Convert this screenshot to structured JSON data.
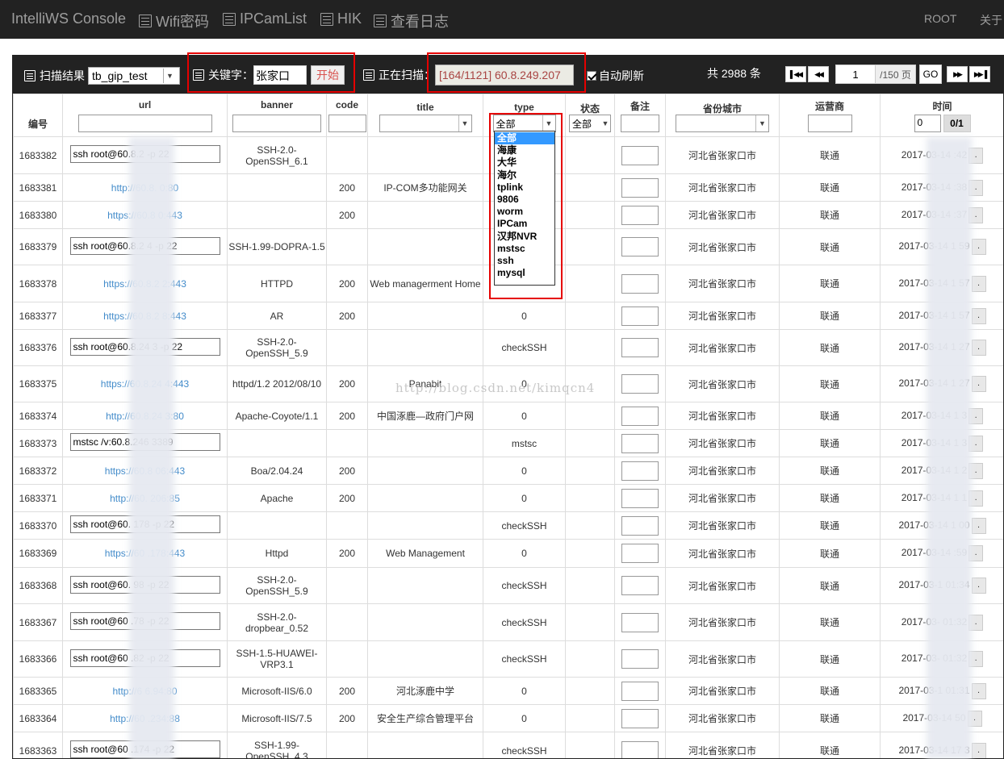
{
  "nav": {
    "brand": "IntelliWS Console",
    "items": [
      "Wifi密码",
      "IPCamList",
      "HIK",
      "查看日志"
    ],
    "right": [
      "ROOT",
      "关于"
    ]
  },
  "toolbar": {
    "scan_result_label": "扫描结果",
    "scan_result_value": "tb_gip_test",
    "keyword_label": "关键字：",
    "keyword_value": "张家口",
    "start_button": "开始",
    "scanning_label": "正在扫描：",
    "scanning_value": "[164/1121] 60.8.249.207",
    "auto_refresh_label": "自动刷新",
    "total_text": "共 2988 条",
    "page_value": "1",
    "page_total": "/150 页",
    "go_button": "GO"
  },
  "columns": {
    "id": "编号",
    "url": "url",
    "banner": "banner",
    "code": "code",
    "title": "title",
    "type": "type",
    "status": "状态",
    "note": "备注",
    "region": "省份城市",
    "isp": "运营商",
    "time": "时间"
  },
  "filters": {
    "type_selected": "全部",
    "status_selected": "全部",
    "time_from": "0",
    "time_button": "0/1"
  },
  "type_options": [
    "全部",
    "海康",
    "大华",
    "海尔",
    "tplink",
    "9806",
    "worm",
    "IPCam",
    "汉邦NVR",
    "mstsc",
    "ssh",
    "mysql"
  ],
  "watermark": "http://blog.csdn.net/kimqcn4",
  "time_button_label": ".",
  "rows": [
    {
      "id": "1683382",
      "url": "ssh root@60.8.2 -p 22",
      "url_kind": "input",
      "banner": "SSH-2.0-OpenSSH_6.1",
      "code": "",
      "title": "",
      "type": "",
      "region": "河北省张家口市",
      "isp": "联通",
      "time": "2017-03-14 :42"
    },
    {
      "id": "1683381",
      "url": "http://60.8. 0:80",
      "url_kind": "link",
      "banner": "",
      "code": "200",
      "title": "IP-COM多功能网关",
      "type": "",
      "region": "河北省张家口市",
      "isp": "联通",
      "time": "2017-03-14 :38"
    },
    {
      "id": "1683380",
      "url": "https://60.8 0:443",
      "url_kind": "link",
      "banner": "",
      "code": "200",
      "title": "",
      "type": "",
      "region": "河北省张家口市",
      "isp": "联通",
      "time": "2017-03-14 :37"
    },
    {
      "id": "1683379",
      "url": "ssh root@60.8.2 4 -p 22",
      "url_kind": "input",
      "banner": "SSH-1.99-DOPRA-1.5",
      "code": "",
      "title": "",
      "type": "",
      "region": "河北省张家口市",
      "isp": "联通",
      "time": "2017-03-14 1 59"
    },
    {
      "id": "1683378",
      "url": "https://60.8.2 2:443",
      "url_kind": "link",
      "banner": "HTTPD",
      "code": "200",
      "title": "Web managerment Home",
      "type": "",
      "region": "河北省张家口市",
      "isp": "联通",
      "time": "2017-03-14 1 57"
    },
    {
      "id": "1683377",
      "url": "https://60.8.2 8:443",
      "url_kind": "link",
      "banner": "AR",
      "code": "200",
      "title": "",
      "type": "0",
      "region": "河北省张家口市",
      "isp": "联通",
      "time": "2017-03-14 1 57"
    },
    {
      "id": "1683376",
      "url": "ssh root@60.8.24 3 -p 22",
      "url_kind": "input",
      "banner": "SSH-2.0-OpenSSH_5.9",
      "code": "",
      "title": "",
      "type": "checkSSH",
      "region": "河北省张家口市",
      "isp": "联通",
      "time": "2017-03-14 1 27"
    },
    {
      "id": "1683375",
      "url": "https://60.8.24 4:443",
      "url_kind": "link",
      "banner": "httpd/1.2 2012/08/10",
      "code": "200",
      "title": "Panabit",
      "type": "0",
      "region": "河北省张家口市",
      "isp": "联通",
      "time": "2017-03-14 1 27"
    },
    {
      "id": "1683374",
      "url": "http://60.8.24 3:80",
      "url_kind": "link",
      "banner": "Apache-Coyote/1.1",
      "code": "200",
      "title": "中国涿鹿—政府门户网",
      "type": "0",
      "region": "河北省张家口市",
      "isp": "联通",
      "time": "2017-03-14 1 3"
    },
    {
      "id": "1683373",
      "url": "mstsc /v:60.8.246 3389",
      "url_kind": "input",
      "banner": "",
      "code": "",
      "title": "",
      "type": "mstsc",
      "region": "河北省张家口市",
      "isp": "联通",
      "time": "2017-03-14 1 3"
    },
    {
      "id": "1683372",
      "url": "https://60.8 06:443",
      "url_kind": "link",
      "banner": "Boa/2.04.24",
      "code": "200",
      "title": "",
      "type": "0",
      "region": "河北省张家口市",
      "isp": "联通",
      "time": "2017-03-14 1 2"
    },
    {
      "id": "1683371",
      "url": "http://60. 206:85",
      "url_kind": "link",
      "banner": "Apache",
      "code": "200",
      "title": "",
      "type": "0",
      "region": "河北省张家口市",
      "isp": "联通",
      "time": "2017-03-14 1 1"
    },
    {
      "id": "1683370",
      "url": "ssh root@60. 178 -p 22",
      "url_kind": "input",
      "banner": "",
      "code": "",
      "title": "",
      "type": "checkSSH",
      "region": "河北省张家口市",
      "isp": "联通",
      "time": "2017-03-14 1 00"
    },
    {
      "id": "1683369",
      "url": "https://60 .178:443",
      "url_kind": "link",
      "banner": "Httpd",
      "code": "200",
      "title": "Web Management",
      "type": "0",
      "region": "河北省张家口市",
      "isp": "联通",
      "time": "2017-03-14 :59"
    },
    {
      "id": "1683368",
      "url": "ssh root@60. 98 -p 22",
      "url_kind": "input",
      "banner": "SSH-2.0-OpenSSH_5.9",
      "code": "",
      "title": "",
      "type": "checkSSH",
      "region": "河北省张家口市",
      "isp": "联通",
      "time": "2017-03-1 01:34"
    },
    {
      "id": "1683367",
      "url": "ssh root@60 .78 -p 22",
      "url_kind": "input",
      "banner": "SSH-2.0-dropbear_0.52",
      "code": "",
      "title": "",
      "type": "checkSSH",
      "region": "河北省张家口市",
      "isp": "联通",
      "time": "2017-03- 01:32"
    },
    {
      "id": "1683366",
      "url": "ssh root@60 .82 -p 22",
      "url_kind": "input",
      "banner": "SSH-1.5-HUAWEI-VRP3.1",
      "code": "",
      "title": "",
      "type": "checkSSH",
      "region": "河北省张家口市",
      "isp": "联通",
      "time": "2017-03- 01:32"
    },
    {
      "id": "1683365",
      "url": "http://6 6.94:80",
      "url_kind": "link",
      "banner": "Microsoft-IIS/6.0",
      "code": "200",
      "title": "河北涿鹿中学",
      "type": "0",
      "region": "河北省张家口市",
      "isp": "联通",
      "time": "2017-03-1 01:31"
    },
    {
      "id": "1683364",
      "url": "http://60 .234:88",
      "url_kind": "link",
      "banner": "Microsoft-IIS/7.5",
      "code": "200",
      "title": "安全生产综合管理平台",
      "type": "0",
      "region": "河北省张家口市",
      "isp": "联通",
      "time": "2017-03-14 50"
    },
    {
      "id": "1683363",
      "url": "ssh root@60 .174 -p 22",
      "url_kind": "input",
      "banner": "SSH-1.99-OpenSSH_4.3",
      "code": "",
      "title": "",
      "type": "checkSSH",
      "region": "河北省张家口市",
      "isp": "联通",
      "time": "2017-03-14 17 3"
    }
  ]
}
